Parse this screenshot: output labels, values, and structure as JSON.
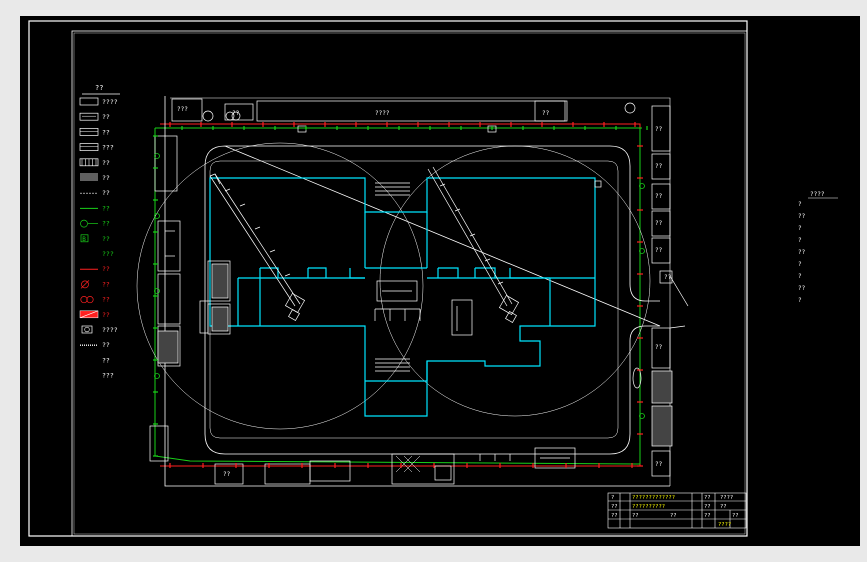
{
  "colors": {
    "background": "#000000",
    "border": "#ffffff",
    "cyan": "#00e5ff",
    "green": "#19d219",
    "red": "#ff2020",
    "yellow": "#ffff00"
  },
  "legend": {
    "title": "??",
    "items": [
      {
        "label": "????",
        "color": "white",
        "symbol": "rect-strip"
      },
      {
        "label": "??",
        "color": "white",
        "symbol": "rect-fill"
      },
      {
        "label": "??",
        "color": "white",
        "symbol": "rect-hatch"
      },
      {
        "label": "???",
        "color": "white",
        "symbol": "rect-hatch"
      },
      {
        "label": "??",
        "color": "white",
        "symbol": "rect-bars"
      },
      {
        "label": "??",
        "color": "white",
        "symbol": "hatch-bars"
      },
      {
        "label": "??",
        "color": "white",
        "symbol": "dash-line"
      },
      {
        "label": "??",
        "color": "green",
        "symbol": "line"
      },
      {
        "label": "??",
        "color": "green",
        "symbol": "circle-line"
      },
      {
        "label": "??",
        "color": "green",
        "symbol": "box-letter"
      },
      {
        "label": "???",
        "color": "green",
        "symbol": "none"
      },
      {
        "label": "??",
        "color": "red",
        "symbol": "line"
      },
      {
        "label": "??",
        "color": "red",
        "symbol": "circle-slash"
      },
      {
        "label": "??",
        "color": "red",
        "symbol": "double-circle"
      },
      {
        "label": "??",
        "color": "red",
        "symbol": "red-block"
      },
      {
        "label": "????",
        "color": "white",
        "symbol": "circle-box"
      },
      {
        "label": "??",
        "color": "white",
        "symbol": "hatch-strip"
      },
      {
        "label": "??",
        "color": "white",
        "symbol": "none"
      },
      {
        "label": "???",
        "color": "white",
        "symbol": "none"
      }
    ]
  },
  "site_labels": {
    "top_boxes": [
      "???",
      "??",
      "??",
      "????",
      "??"
    ],
    "right_boxes": [
      "??",
      "??",
      "??",
      "??",
      "??",
      "??"
    ],
    "right_lower_boxes": [
      "??",
      "??"
    ],
    "bottom_box": "??",
    "letter_box": "B"
  },
  "side_note": {
    "header": "????",
    "lines": [
      "?",
      "??",
      "?",
      "?",
      "??",
      "?",
      "?",
      "??",
      "?"
    ]
  },
  "title_block": {
    "project_line1": "?????????????",
    "project_line2": "??????????",
    "cells": [
      "?",
      "??",
      "????",
      "??",
      "??",
      "??",
      "??",
      "??",
      "??",
      "??",
      "??",
      "????"
    ]
  }
}
